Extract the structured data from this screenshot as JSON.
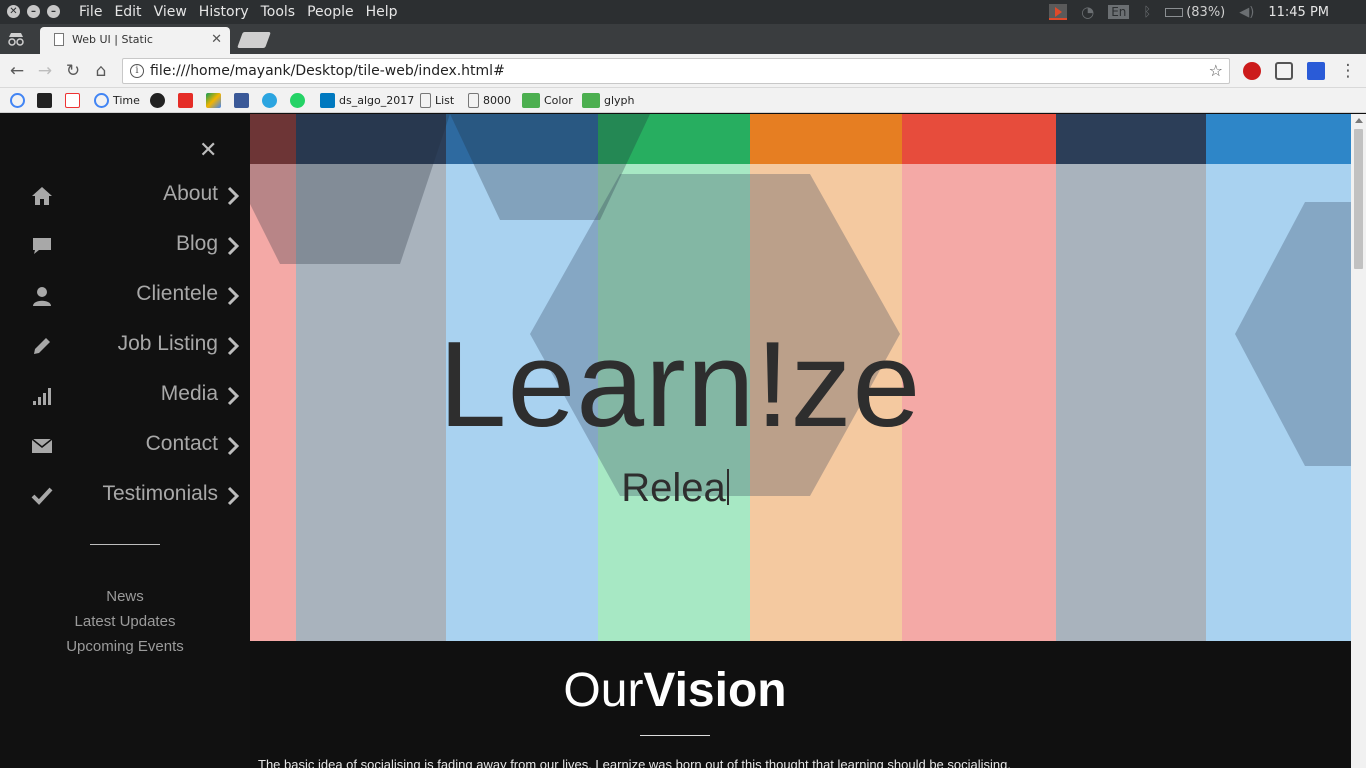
{
  "os": {
    "menu": [
      "File",
      "Edit",
      "View",
      "History",
      "Tools",
      "People",
      "Help"
    ],
    "keyboard_layout": "En",
    "battery": "(83%)",
    "clock": "11:45 PM"
  },
  "browser": {
    "tab_title": "Web UI | Static",
    "url": "file:///home/mayank/Desktop/tile-web/index.html#",
    "bookmarks": [
      {
        "label": "",
        "icon": "google-icon"
      },
      {
        "label": "",
        "icon": "bookmark-icon"
      },
      {
        "label": "",
        "icon": "backpack-icon"
      },
      {
        "label": "Time",
        "icon": "google-icon"
      },
      {
        "label": "",
        "icon": "github-icon"
      },
      {
        "label": "",
        "icon": "youtube-icon"
      },
      {
        "label": "",
        "icon": "drive-icon"
      },
      {
        "label": "",
        "icon": "facebook-icon"
      },
      {
        "label": "",
        "icon": "telegram-icon"
      },
      {
        "label": "",
        "icon": "whatsapp-icon"
      },
      {
        "label": "ds_algo_2017",
        "icon": "trello-icon"
      },
      {
        "label": "List",
        "icon": "page-icon"
      },
      {
        "label": "8000",
        "icon": "page-icon"
      },
      {
        "label": "Color",
        "icon": "w3-icon"
      },
      {
        "label": "glyph",
        "icon": "w3-icon"
      }
    ]
  },
  "sidebar": {
    "items": [
      {
        "label": "About",
        "icon": "home-icon"
      },
      {
        "label": "Blog",
        "icon": "comment-icon"
      },
      {
        "label": "Clientele",
        "icon": "user-icon"
      },
      {
        "label": "Job Listing",
        "icon": "pencil-icon"
      },
      {
        "label": "Media",
        "icon": "signal-icon"
      },
      {
        "label": "Contact",
        "icon": "envelope-icon"
      },
      {
        "label": "Testimonials",
        "icon": "check-icon"
      }
    ],
    "links": [
      "News",
      "Latest Updates",
      "Upcoming Events"
    ]
  },
  "hero": {
    "title": "Learn!ze",
    "subtitle": "Relea",
    "stripe_colors": [
      "#f4a9a6",
      "#a9b3bd",
      "#a9d2f0",
      "#a7e8c4",
      "#f4c9a0",
      "#f4a9a6",
      "#a9b3bd",
      "#a9d2f0"
    ],
    "band_colors": [
      "#8c3a36",
      "#2c3e58",
      "#2e6aa0",
      "#27ae60",
      "#e67e22",
      "#e74c3c",
      "#2c3e58",
      "#2e86c8"
    ]
  },
  "vision": {
    "title_light": "Our",
    "title_bold": "Vision",
    "text": "The basic idea of socialising is fading away from our lives. Learnize was born out of this thought that learning should be socialising."
  }
}
